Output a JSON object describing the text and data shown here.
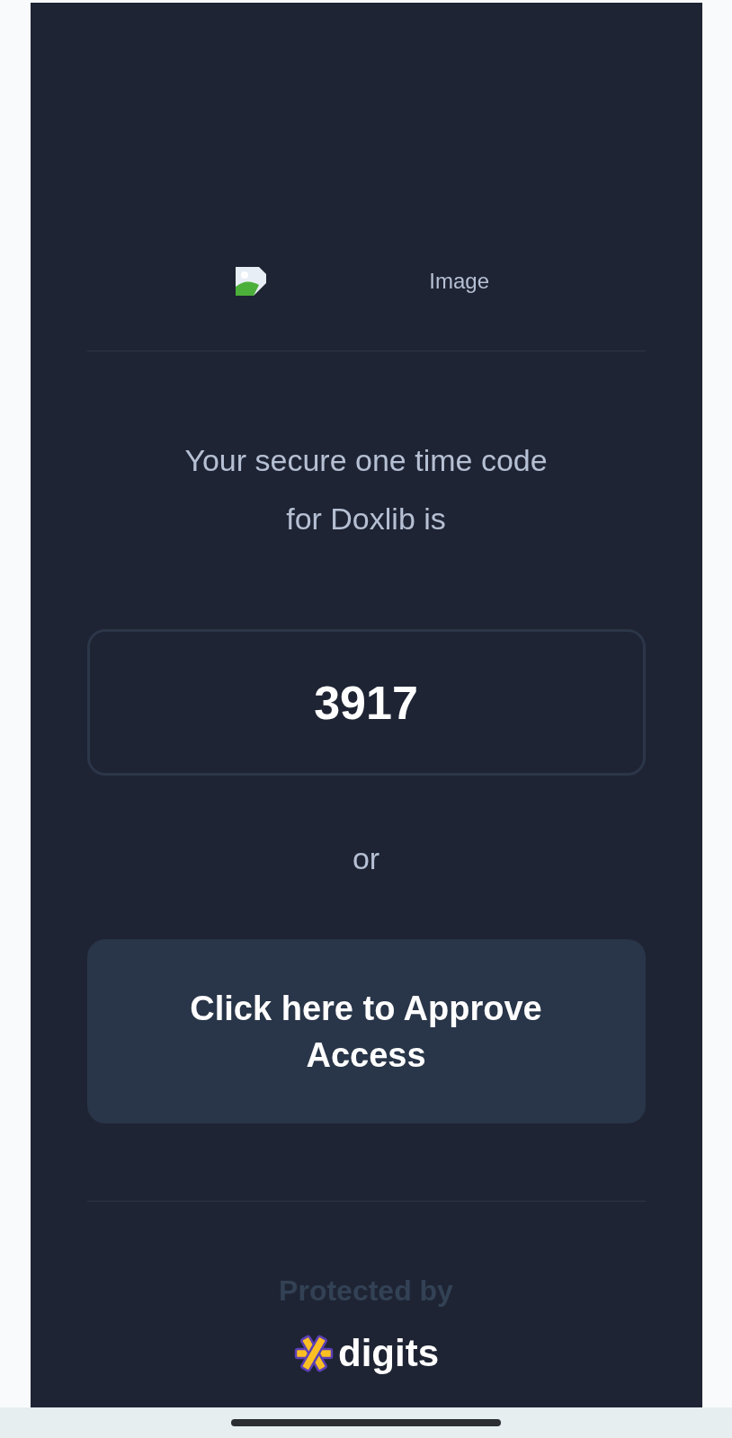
{
  "image": {
    "alt": "Image"
  },
  "message": "Your secure one time code for Doxlib is",
  "code": "3917",
  "separator": "or",
  "approve_button": {
    "label": "Click here to Approve Access"
  },
  "footer": {
    "protected_by": "Protected by",
    "brand": "digits"
  }
}
